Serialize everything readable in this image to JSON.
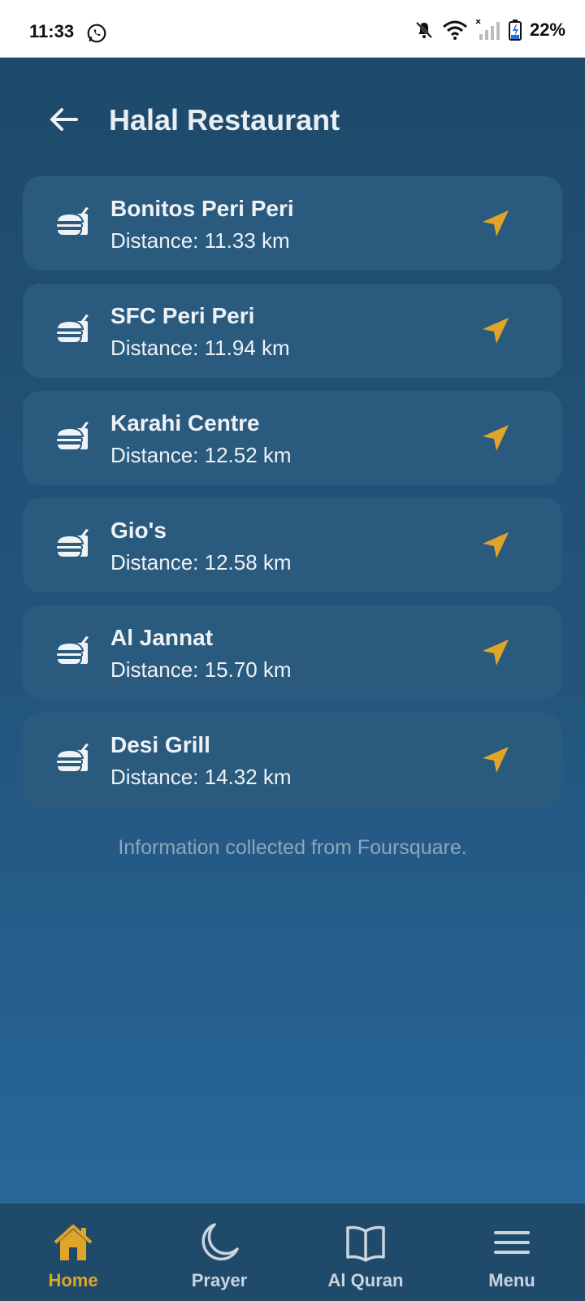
{
  "status_bar": {
    "time": "11:33",
    "battery": "22%",
    "icons": [
      "whatsapp-icon",
      "mute-icon",
      "wifi-icon",
      "signal-icon",
      "battery-icon"
    ]
  },
  "header": {
    "title": "Halal Restaurant",
    "back_icon": "arrow-left-icon"
  },
  "restaurants": [
    {
      "name": "Bonitos Peri Peri",
      "distance": "Distance: 11.33 km"
    },
    {
      "name": "SFC Peri Peri",
      "distance": "Distance: 11.94 km"
    },
    {
      "name": "Karahi Centre",
      "distance": "Distance: 12.52 km"
    },
    {
      "name": "Gio's",
      "distance": "Distance: 12.58 km"
    },
    {
      "name": "Al Jannat",
      "distance": "Distance: 15.70 km"
    },
    {
      "name": "Desi Grill",
      "distance": "Distance: 14.32 km"
    }
  ],
  "footer_note": "Information collected from Foursquare.",
  "bottom_nav": {
    "items": [
      {
        "label": "Home",
        "icon": "home-icon",
        "active": true
      },
      {
        "label": "Prayer",
        "icon": "moon-icon",
        "active": false
      },
      {
        "label": "Al Quran",
        "icon": "book-icon",
        "active": false
      },
      {
        "label": "Menu",
        "icon": "menu-icon",
        "active": false
      }
    ]
  },
  "colors": {
    "accent": "#e0a528",
    "card": "#2a5a7e",
    "background_top": "#1e4a6b",
    "background_bottom": "#27679a",
    "nav_bar": "#1f4a6a"
  }
}
